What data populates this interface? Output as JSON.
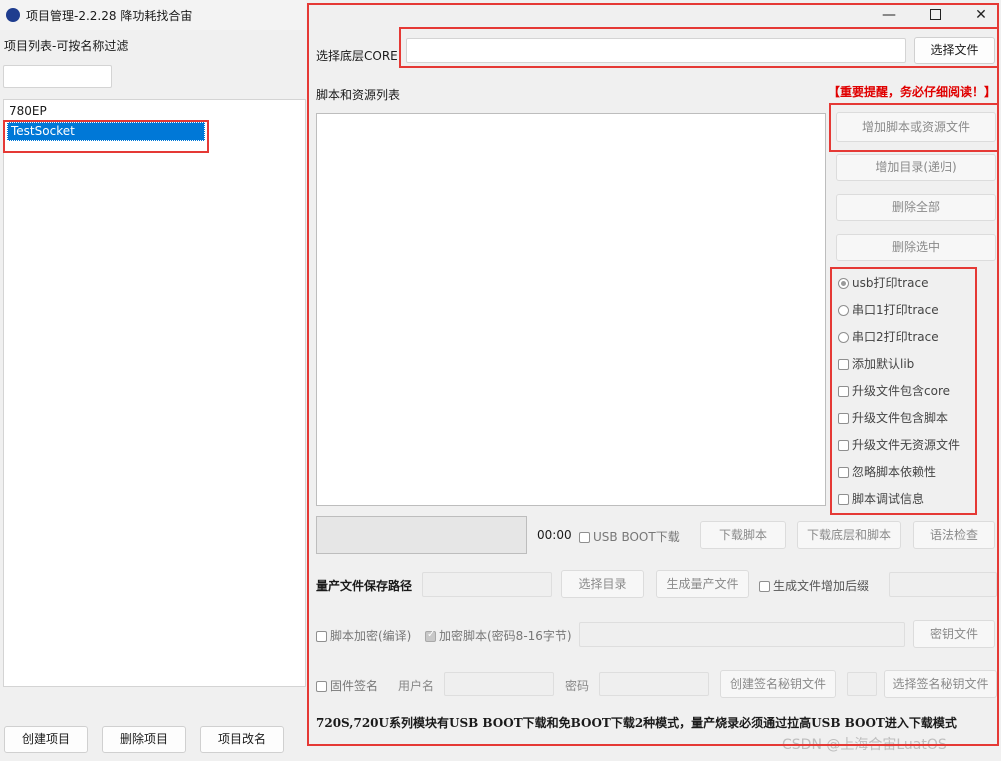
{
  "window": {
    "title": "项目管理-2.2.28 降功耗找合宙",
    "app_icon": "luatos-logo-icon"
  },
  "sidebar": {
    "heading": "项目列表-可按名称过滤",
    "filter_value": "",
    "items": [
      {
        "label": "780EP",
        "selected": false
      },
      {
        "label": "TestSocket",
        "selected": true
      }
    ],
    "buttons": {
      "create": "创建项目",
      "delete": "删除项目",
      "rename": "项目改名"
    }
  },
  "core": {
    "label": "选择底层CORE",
    "value": "",
    "button": "选择文件"
  },
  "scripts": {
    "label": "脚本和资源列表",
    "warning": "【重要提醒，务必仔细阅读！】",
    "buttons": {
      "add_files": "增加脚本或资源文件",
      "add_dir": "增加目录(递归)",
      "delete_all": "删除全部",
      "delete_selected": "删除选中"
    }
  },
  "options": {
    "radios": [
      {
        "label": "usb打印trace",
        "checked": true
      },
      {
        "label": "串口1打印trace",
        "checked": false
      },
      {
        "label": "串口2打印trace",
        "checked": false
      }
    ],
    "checks": [
      {
        "label": "添加默认lib",
        "checked": false
      },
      {
        "label": "升级文件包含core",
        "checked": false
      },
      {
        "label": "升级文件包含脚本",
        "checked": false
      },
      {
        "label": "升级文件无资源文件",
        "checked": false
      },
      {
        "label": "忽略脚本依赖性",
        "checked": false
      },
      {
        "label": "脚本调试信息",
        "checked": false
      }
    ]
  },
  "download": {
    "timer": "00:00",
    "usb_boot_label": "USB BOOT下载",
    "download_script": "下载脚本",
    "download_core_script": "下载底层和脚本",
    "syntax_check": "语法检查"
  },
  "production": {
    "path_label": "量产文件保存路径",
    "select_dir": "选择目录",
    "generate": "生成量产文件",
    "suffix_label": "生成文件增加后缀"
  },
  "encrypt": {
    "script_encrypt": "脚本加密(编译)",
    "encrypt_script": "加密脚本(密码8-16字节)",
    "key_file": "密钥文件"
  },
  "sign": {
    "firmware_sign": "固件签名",
    "username": "用户名",
    "password": "密码",
    "create_key": "创建签名秘钥文件",
    "select_key": "选择签名秘钥文件"
  },
  "footer_note": "720S,720U系列模块有USB BOOT下载和免BOOT下载2种模式，量产烧录必须通过拉高USB BOOT进入下载模式",
  "watermark": "CSDN @上海合宙LuatOS",
  "colors": {
    "selection": "#0078d7",
    "highlight_box": "#e53935",
    "warning_text": "#e00000"
  }
}
